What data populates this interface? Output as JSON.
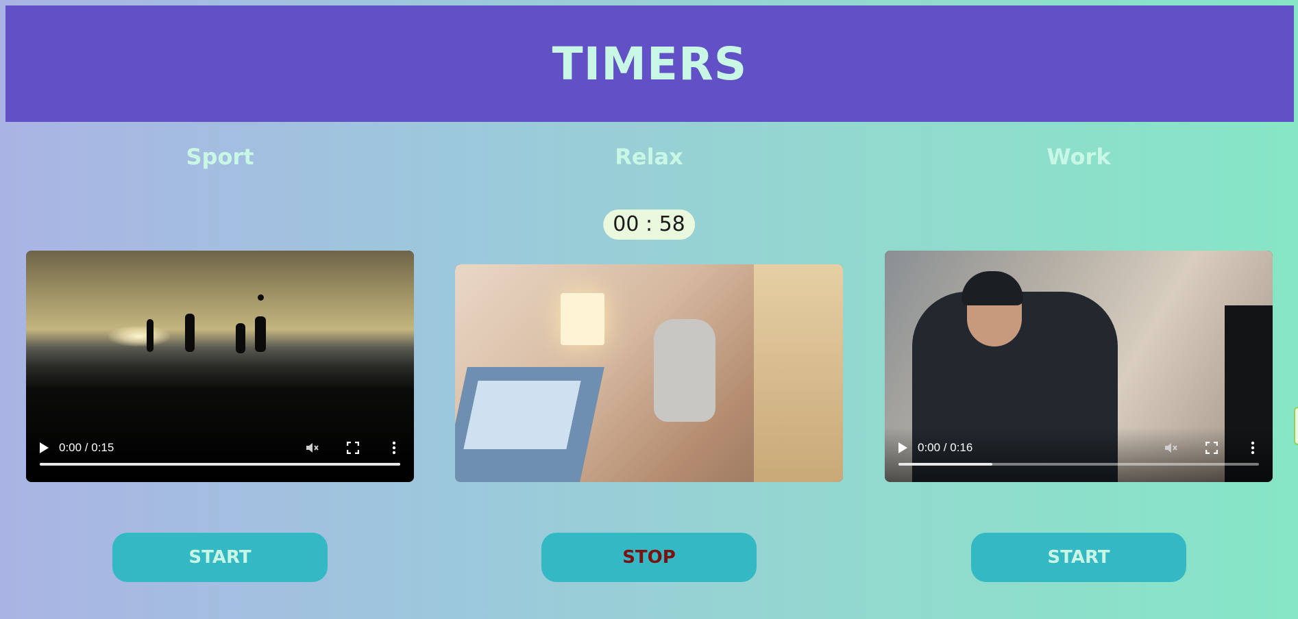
{
  "header": {
    "title": "TIMERS"
  },
  "colors": {
    "header_bg": "#6150c6",
    "title_text": "#c9f7e6",
    "button_bg": "#33b8c4",
    "stop_text": "#7a1212",
    "timer_bg": "#eaf8de"
  },
  "columns": [
    {
      "title": "Sport",
      "video": {
        "time": "0:00 / 0:15",
        "progress": 1.0,
        "muted": true,
        "controls_visible": true
      },
      "button": "START"
    },
    {
      "title": "Relax",
      "timer": "00 : 58",
      "video": {
        "controls_visible": false
      },
      "button": "STOP"
    },
    {
      "title": "Work",
      "video": {
        "time": "0:00 / 0:16",
        "progress": 0.26,
        "muted": true,
        "controls_visible": true
      },
      "button": "START"
    }
  ],
  "icons": [
    "play-icon",
    "mute-icon",
    "fullscreen-icon",
    "more-options-icon"
  ]
}
